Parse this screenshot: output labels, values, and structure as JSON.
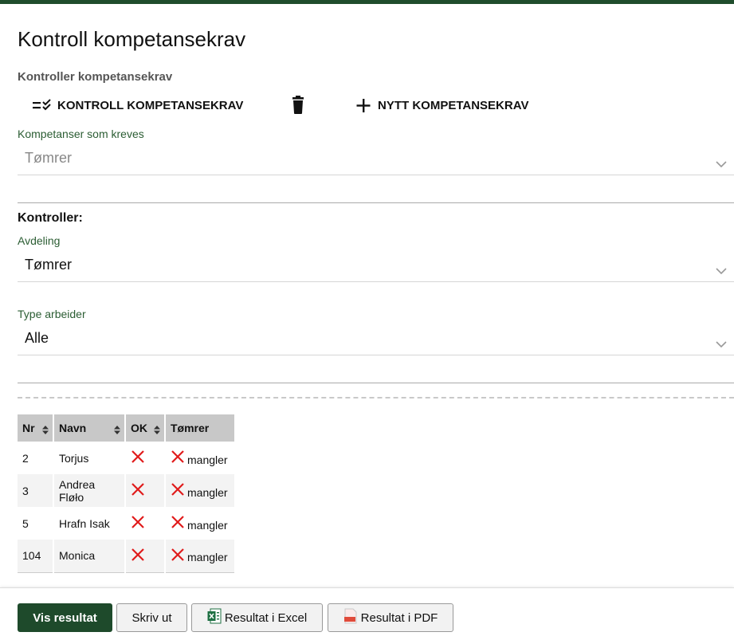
{
  "page": {
    "title": "Kontroll kompetansekrav"
  },
  "section": {
    "title": "Kontroller kompetansekrav"
  },
  "toolbar": {
    "check_label": "KONTROLL KOMPETANSEKRAV",
    "new_label": "NYTT KOMPETANSEKRAV"
  },
  "required": {
    "label": "Kompetanser som kreves",
    "value": "Tømrer"
  },
  "controls": {
    "heading": "Kontroller:",
    "department": {
      "label": "Avdeling",
      "value": "Tømrer"
    },
    "worker_type": {
      "label": "Type arbeider",
      "value": "Alle"
    }
  },
  "table": {
    "headers": [
      "Nr",
      "Navn",
      "OK",
      "Tømrer"
    ],
    "rows": [
      {
        "nr": "2",
        "name": "Torjus",
        "status": "mangler"
      },
      {
        "nr": "3",
        "name": "Andrea Fløło",
        "status": "mangler"
      },
      {
        "nr": "5",
        "name": "Hrafn Isak",
        "status": "mangler"
      },
      {
        "nr": "104",
        "name": "Monica",
        "status": "mangler"
      }
    ]
  },
  "footer": {
    "show_label": "Vis resultat",
    "print_label": "Skriv ut",
    "excel_label": "Resultat i Excel",
    "pdf_label": "Resultat i PDF"
  },
  "colors": {
    "brand": "#1e4a2b",
    "error": "#e01b1b",
    "label": "#2b5d33"
  }
}
